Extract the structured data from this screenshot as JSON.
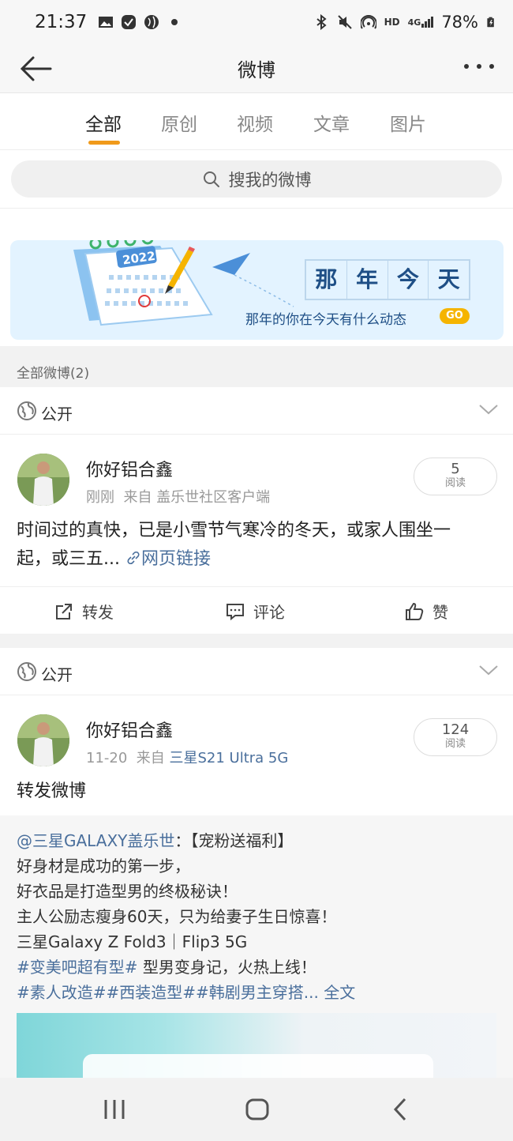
{
  "status_bar": {
    "time": "21:37",
    "battery": "78%",
    "icons": [
      "gallery-icon",
      "check-app-icon",
      "globe-app-icon",
      "dot-icon",
      "bluetooth-icon",
      "mute-icon",
      "hotspot-icon",
      "hd-icon",
      "4g-signal-icon",
      "battery-icon"
    ],
    "hd": "HD",
    "net": "4G"
  },
  "header": {
    "title": "微博"
  },
  "tabs": [
    {
      "label": "全部",
      "active": true
    },
    {
      "label": "原创",
      "active": false
    },
    {
      "label": "视频",
      "active": false
    },
    {
      "label": "文章",
      "active": false
    },
    {
      "label": "图片",
      "active": false
    }
  ],
  "search": {
    "placeholder": "搜我的微博"
  },
  "banner": {
    "title_chars": [
      "那",
      "年",
      "今",
      "天"
    ],
    "subtitle": "那年的你在今天有什么动态",
    "go_label": "GO",
    "calendar_year": "2022"
  },
  "section": {
    "title": "全部微博(2)"
  },
  "posts": [
    {
      "visibility": "公开",
      "author": "你好铝合鑫",
      "time": "刚刚",
      "source_prefix": "来自",
      "source": "盖乐世社区客户端",
      "reads_count": "5",
      "reads_label": "阅读",
      "text_line1": "时间过的真快，已是小雪节气寒冷的冬天，或家人围坐一",
      "text_line2": "起，或三五...",
      "link_text": "网页链接",
      "actions": {
        "repost": "转发",
        "comment": "评论",
        "like": "赞"
      }
    },
    {
      "visibility": "公开",
      "author": "你好铝合鑫",
      "time": "11-20",
      "source_prefix": "来自",
      "source": "三星S21 Ultra 5G",
      "reads_count": "124",
      "reads_label": "阅读",
      "text": "转发微博",
      "retweet": {
        "mention": "@三星GALAXY盖乐世",
        "headline": "：【宠粉送福利】",
        "line1": "好身材是成功的第一步，",
        "line2": "好衣品是打造型男的终极秘诀！",
        "line3": "主人公励志瘦身60天，只为给妻子生日惊喜！",
        "line4": "三星Galaxy Z Fold3｜Flip3 5G",
        "topic1": "#变美吧超有型#",
        "line5_rest": " 型男变身记，火热上线！",
        "topics": "#素人改造##西装造型##韩剧男主穿搭...",
        "full_text": " 全文"
      }
    }
  ],
  "colors": {
    "accent": "#f09a1b",
    "link": "#4a6f9c",
    "banner_bg": "#e3f3ff",
    "banner_text": "#1f4f86"
  }
}
